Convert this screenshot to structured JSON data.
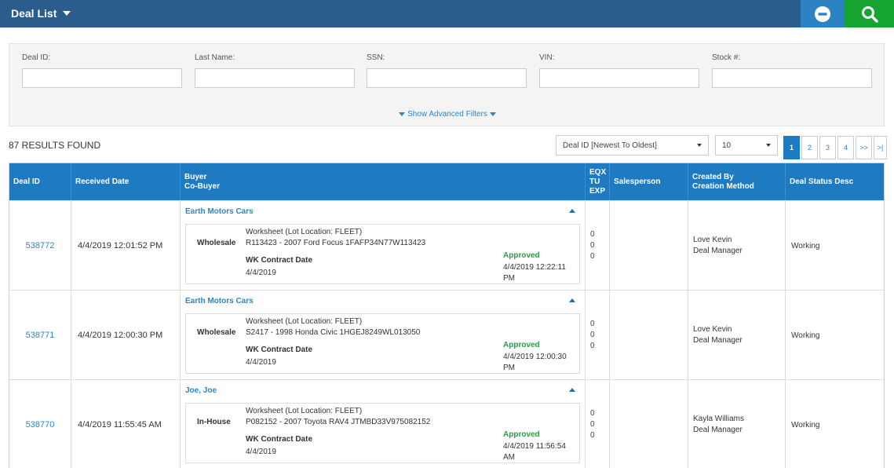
{
  "header": {
    "title": "Deal List"
  },
  "filters": {
    "deal_id_label": "Deal ID:",
    "last_name_label": "Last Name:",
    "ssn_label": "SSN:",
    "vin_label": "VIN:",
    "stock_label": "Stock #:",
    "advanced_label": "Show Advanced Filters"
  },
  "results": {
    "count_text": "87 RESULTS FOUND",
    "sort_value": "Deal ID [Newest To Oldest]",
    "page_size_value": "10",
    "pages": [
      "1",
      "2",
      "3",
      "4",
      ">>",
      ">|"
    ],
    "current_page": "1"
  },
  "table": {
    "headers": {
      "deal_id": "Deal ID",
      "received": "Received Date",
      "buyer": "Buyer",
      "cobuyer": "Co-Buyer",
      "eqx": "EQX",
      "tu": "TU",
      "exp": "EXP",
      "salesperson": "Salesperson",
      "created_by": "Created By",
      "creation_method": "Creation Method",
      "status": "Deal Status Desc"
    },
    "rows": [
      {
        "deal_id": "538772",
        "received": "4/4/2019 12:01:52 PM",
        "buyer": "Earth Motors Cars",
        "worksheet": "Worksheet  (Lot Location: FLEET)",
        "type": "Wholesale",
        "vehicle": "R113423 - 2007 Ford Focus 1FAFP34N77W113423",
        "wk_label": "WK Contract Date",
        "wk_date": "4/4/2019",
        "approved_label": "Approved",
        "approved_date": "4/4/2019 12:22:11 PM",
        "eqx": "0",
        "tu": "0",
        "exp": "0",
        "salesperson": "",
        "created_by": "Love Kevin",
        "creation_method": "Deal Manager",
        "status": "Working"
      },
      {
        "deal_id": "538771",
        "received": "4/4/2019 12:00:30 PM",
        "buyer": "Earth Motors Cars",
        "worksheet": "Worksheet  (Lot Location: FLEET)",
        "type": "Wholesale",
        "vehicle": "S2417 - 1998 Honda Civic 1HGEJ8249WL013050",
        "wk_label": "WK Contract Date",
        "wk_date": "4/4/2019",
        "approved_label": "Approved",
        "approved_date": "4/4/2019 12:00:30 PM",
        "eqx": "0",
        "tu": "0",
        "exp": "0",
        "salesperson": "",
        "created_by": "Love Kevin",
        "creation_method": "Deal Manager",
        "status": "Working"
      },
      {
        "deal_id": "538770",
        "received": "4/4/2019 11:55:45 AM",
        "buyer": "Joe, Joe",
        "worksheet": "Worksheet  (Lot Location: FLEET)",
        "type": "In-House",
        "vehicle": "P082152 - 2007 Toyota RAV4 JTMBD33V975082152",
        "wk_label": "WK Contract Date",
        "wk_date": "4/4/2019",
        "approved_label": "Approved",
        "approved_date": "4/4/2019 11:56:54 AM",
        "eqx": "0",
        "tu": "0",
        "exp": "0",
        "salesperson": "",
        "created_by": "Kayla Williams",
        "creation_method": "Deal Manager",
        "status": "Working"
      }
    ]
  }
}
